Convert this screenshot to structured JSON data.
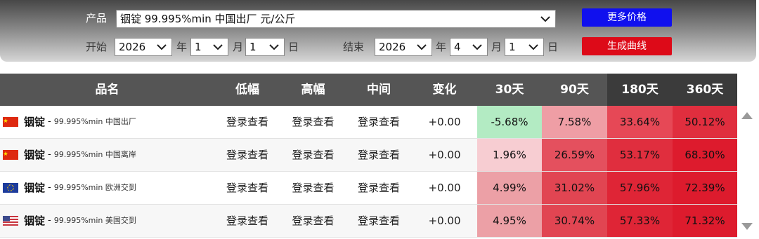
{
  "filter": {
    "product_label": "产品",
    "product_value": "铟锭 99.995%min 中国出厂 元/公斤",
    "start_label": "开始",
    "end_label": "结束",
    "start": {
      "year": "2026",
      "month": "1",
      "day": "1"
    },
    "end": {
      "year": "2026",
      "month": "4",
      "day": "1"
    },
    "unit_year": "年",
    "unit_month": "月",
    "unit_day": "日",
    "more_prices_button": "更多价格",
    "generate_curve_button": "生成曲线"
  },
  "table": {
    "headers": [
      "品名",
      "低幅",
      "高幅",
      "中间",
      "变化",
      "30天",
      "90天",
      "180天",
      "360天"
    ],
    "rows": [
      {
        "flag": "china-flag-icon",
        "metal": "铟锭",
        "spec": "99.995%min 中国出厂",
        "low": "登录查看",
        "high": "登录查看",
        "mid": "登录查看",
        "change": "+0.00",
        "d30": "-5.68%",
        "d90": "7.58%",
        "d180": "33.64%",
        "d360": "50.12%"
      },
      {
        "flag": "china-flag-icon",
        "metal": "铟锭",
        "spec": "99.995%min 中国离岸",
        "low": "登录查看",
        "high": "登录查看",
        "mid": "登录查看",
        "change": "+0.00",
        "d30": "1.96%",
        "d90": "26.59%",
        "d180": "53.17%",
        "d360": "68.30%"
      },
      {
        "flag": "eu-flag-icon",
        "metal": "铟锭",
        "spec": "99.995%min 欧洲交到",
        "low": "登录查看",
        "high": "登录查看",
        "mid": "登录查看",
        "change": "+0.00",
        "d30": "4.99%",
        "d90": "31.02%",
        "d180": "57.96%",
        "d360": "72.39%"
      },
      {
        "flag": "us-flag-icon",
        "metal": "铟锭",
        "spec": "99.995%min 美国交到",
        "low": "登录查看",
        "high": "登录查看",
        "mid": "登录查看",
        "change": "+0.00",
        "d30": "4.95%",
        "d90": "30.74%",
        "d180": "57.33%",
        "d360": "71.32%"
      }
    ],
    "cell_colors": [
      [
        "#b3ebc3",
        "#ef9ea5",
        "#e64856",
        "#e02e3e"
      ],
      [
        "#f7cdd2",
        "#e4505e",
        "#e02e3e",
        "#dd1b2d"
      ],
      [
        "#eca0a6",
        "#e14552",
        "#df2536",
        "#dd1b2d"
      ],
      [
        "#eca0a6",
        "#e14552",
        "#df2536",
        "#dd1b2d"
      ]
    ]
  },
  "colors": {
    "header_bg": "#555555",
    "header_dark_bg": "#3b3b3b",
    "blue_button": "#1010ee",
    "red_button": "#dd0a18"
  }
}
